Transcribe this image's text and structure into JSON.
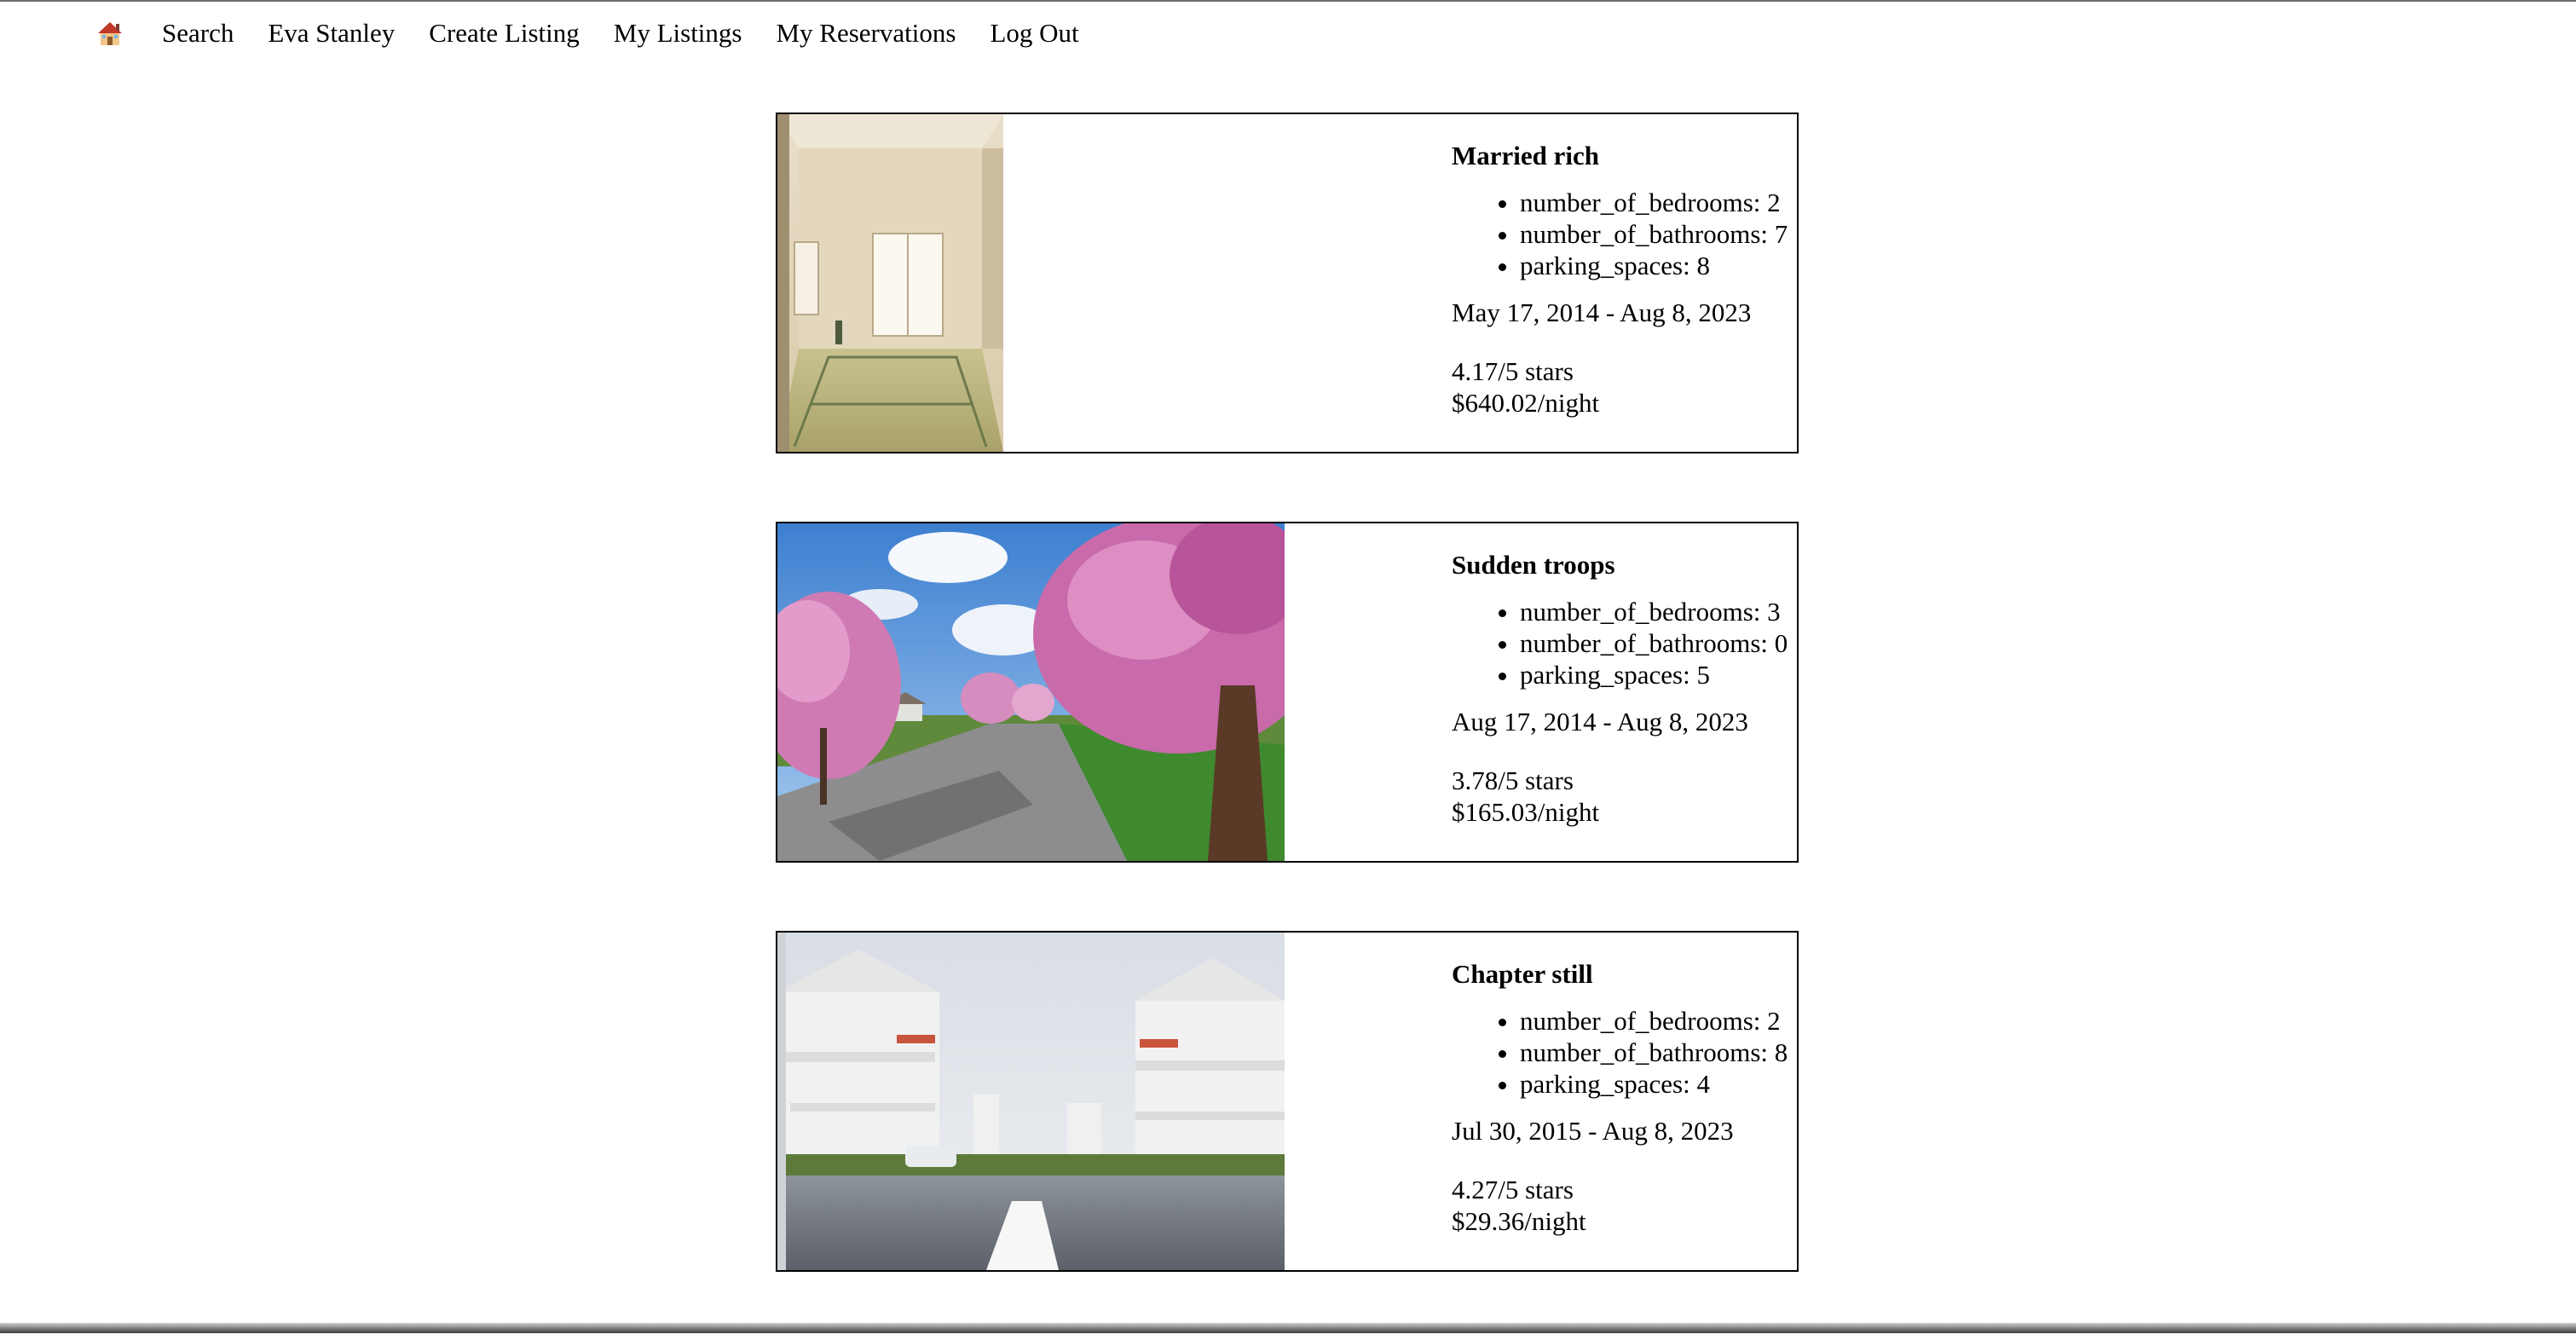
{
  "nav": {
    "home_icon": "house-emoji-icon",
    "items": [
      "Search",
      "Eva Stanley",
      "Create Listing",
      "My Listings",
      "My Reservations",
      "Log Out"
    ]
  },
  "listings": [
    {
      "title": "Married rich",
      "features": [
        "number_of_bedrooms: 2",
        "number_of_bathrooms: 7",
        "parking_spaces: 8"
      ],
      "dates": "May 17, 2014 - Aug 8, 2023",
      "rating": "4.17/5 stars",
      "price": "$640.02/night",
      "image": "tatami-room-photo"
    },
    {
      "title": "Sudden troops",
      "features": [
        "number_of_bedrooms: 3",
        "number_of_bathrooms: 0",
        "parking_spaces: 5"
      ],
      "dates": "Aug 17, 2014 - Aug 8, 2023",
      "rating": "3.78/5 stars",
      "price": "$165.03/night",
      "image": "cherry-blossom-street-photo"
    },
    {
      "title": "Chapter still",
      "features": [
        "number_of_bedrooms: 2",
        "number_of_bathrooms: 8",
        "parking_spaces: 4"
      ],
      "dates": "Jul 30, 2015 - Aug 8, 2023",
      "rating": "4.27/5 stars",
      "price": "$29.36/night",
      "image": "white-houses-street-photo"
    }
  ]
}
